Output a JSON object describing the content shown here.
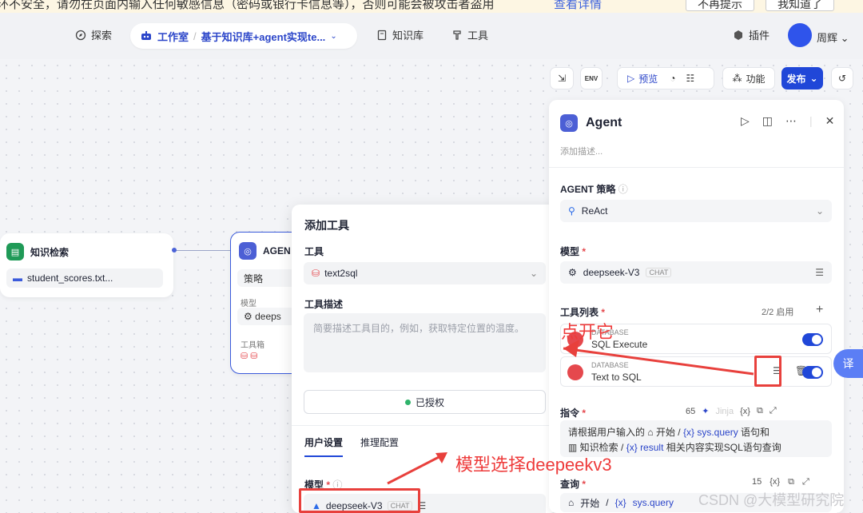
{
  "warning": {
    "message": "环不安全，请勿在页面内输入任何敏感信息（密码或银行卡信息等），否则可能会被攻击者盗用",
    "link": "查看详情",
    "btn1": "不再提示",
    "btn2": "我知道了"
  },
  "nav": {
    "explore": "探索",
    "workspace": "工作室",
    "app_name": "基于知识库+agent实现te...",
    "knowledge": "知识库",
    "tools": "工具",
    "plugins": "插件",
    "user": "周辉"
  },
  "toolbar": {
    "preview": "预览",
    "features": "功能",
    "publish": "发布"
  },
  "nodes": {
    "kb": {
      "title": "知识检索",
      "file": "student_scores.txt..."
    },
    "agent": {
      "title": "AGEN",
      "strategy": "策略",
      "model_label": "模型",
      "model": "deeps",
      "toolbox_label": "工具箱"
    }
  },
  "popup": {
    "title": "添加工具",
    "tool_label": "工具",
    "tool_value": "text2sql",
    "desc_label": "工具描述",
    "desc_placeholder": "简要描述工具目的，例如，获取特定位置的温度。",
    "authorized": "已授权",
    "tab_user": "用户设置",
    "tab_reason": "推理配置",
    "model_label": "模型",
    "model_value": "deepseek-V3",
    "chat_tag": "CHAT"
  },
  "panel": {
    "title": "Agent",
    "desc": "添加描述...",
    "strategy_label": "AGENT 策略",
    "strategy_value": "ReAct",
    "model_label": "模型",
    "model_value": "deepseek-V3",
    "chat_tag": "CHAT",
    "tools_label": "工具列表",
    "tools_count": "2/2 启用",
    "tools": [
      {
        "kind": "DATABASE",
        "name": "SQL Execute"
      },
      {
        "kind": "DATABASE",
        "name": "Text to SQL"
      }
    ],
    "instruction_label": "指令",
    "instruction_count": "65",
    "jinja": "Jinja",
    "instruction_l1a": "请根据用户输入的",
    "instruction_start": "开始",
    "instruction_var1": "sys.query",
    "instruction_l1b": "语句和",
    "instruction_kb": "知识检索",
    "instruction_var2": "result",
    "instruction_l2b": "相关内容实现SQL语句查询",
    "query_label": "查询",
    "query_count": "15",
    "query_start": "开始",
    "query_var": "sys.query"
  },
  "annotations": {
    "open": "点开它",
    "model": "模型选择deepeekv3"
  },
  "translate": "译",
  "watermark": "CSDN @大模型研究院"
}
